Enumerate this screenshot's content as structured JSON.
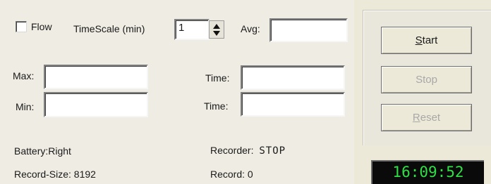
{
  "flow": {
    "label": "Flow",
    "checked": false
  },
  "timescale": {
    "label": "TimeScale (min)",
    "value": "1"
  },
  "avg": {
    "label": "Avg:",
    "value": ""
  },
  "max": {
    "label": "Max:",
    "value": ""
  },
  "min": {
    "label": "Min:",
    "value": ""
  },
  "time_max": {
    "label": "Time:",
    "value": ""
  },
  "time_min": {
    "label": "Time:",
    "value": ""
  },
  "status": {
    "battery": "Battery:Right",
    "record_size": "Record-Size: 8192",
    "recorder_label": "Recorder:",
    "recorder_value": "STOP",
    "record": "Record: 0"
  },
  "buttons": {
    "start": {
      "first": "S",
      "rest": "tart",
      "enabled": true
    },
    "stop": {
      "first": "",
      "rest": "Stop",
      "enabled": false
    },
    "reset": {
      "first": "R",
      "rest": "eset",
      "enabled": false
    }
  },
  "clock": "16:09:52",
  "colors": {
    "clock_digits": "#2ee045",
    "clock_bg": "#0a0a0a",
    "dialog_bg": "#ece9d8"
  }
}
